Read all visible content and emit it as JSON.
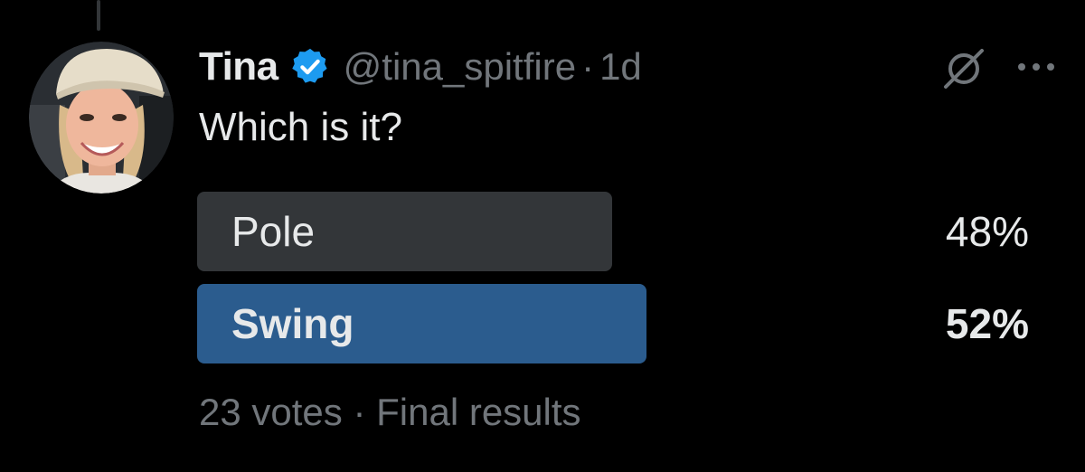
{
  "tweet": {
    "display_name": "Tina",
    "handle": "@tina_spitfire",
    "separator": "·",
    "time": "1d",
    "text": "Which is it?",
    "verified": true
  },
  "poll": {
    "options": [
      {
        "label": "Pole",
        "percent": "48%",
        "value": 48,
        "winner": false
      },
      {
        "label": "Swing",
        "percent": "52%",
        "value": 52,
        "winner": true
      }
    ],
    "votes": "23 votes",
    "separator": "·",
    "status": "Final results"
  },
  "colors": {
    "background": "#000000",
    "text_primary": "#e7e9ea",
    "text_secondary": "#71767b",
    "poll_bar": "#333639",
    "poll_winner_bar": "#2b5c8e",
    "verified_badge": "#1d9bf0"
  },
  "icons": {
    "verified": "verified-badge-icon",
    "grok": "grok-icon",
    "more": "more-options-icon"
  }
}
